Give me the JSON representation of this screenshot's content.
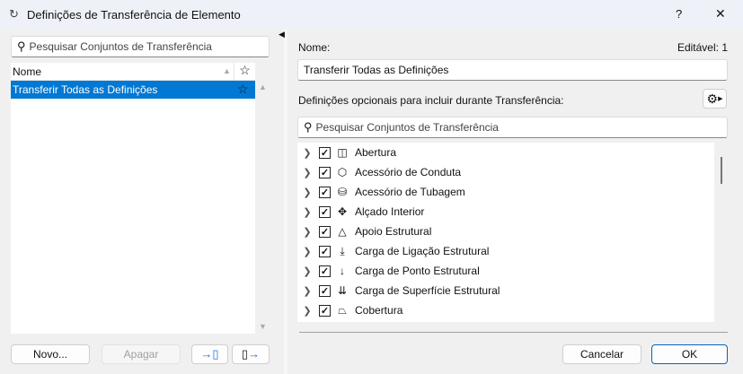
{
  "window": {
    "title": "Definições de Transferência de Elemento",
    "help": "?",
    "close": "✕"
  },
  "left": {
    "search_placeholder": "Pesquisar Conjuntos de Transferência",
    "column_name": "Nome",
    "rows": [
      {
        "name": "Transferir Todas as Definições",
        "selected": true
      }
    ],
    "buttons": {
      "new": "Novo...",
      "delete": "Apagar"
    }
  },
  "right": {
    "name_label": "Nome:",
    "editable": "Editável: 1",
    "name_value": "Transferir Todas as Definições",
    "optional_label": "Definições opcionais para incluir durante Transferência:",
    "search_placeholder": "Pesquisar Conjuntos de Transferência",
    "items": [
      {
        "label": "Abertura",
        "checked": true,
        "icon": "opening-icon"
      },
      {
        "label": "Acessório de Conduta",
        "checked": true,
        "icon": "duct-fitting-icon"
      },
      {
        "label": "Acessório de Tubagem",
        "checked": true,
        "icon": "pipe-fitting-icon"
      },
      {
        "label": "Alçado Interior",
        "checked": true,
        "icon": "interior-elevation-icon"
      },
      {
        "label": "Apoio Estrutural",
        "checked": true,
        "icon": "structural-support-icon"
      },
      {
        "label": "Carga de Ligação Estrutural",
        "checked": true,
        "icon": "line-load-icon"
      },
      {
        "label": "Carga de Ponto Estrutural",
        "checked": true,
        "icon": "point-load-icon"
      },
      {
        "label": "Carga de Superfície Estrutural",
        "checked": true,
        "icon": "surface-load-icon"
      },
      {
        "label": "Cobertura",
        "checked": true,
        "icon": "roof-icon"
      }
    ],
    "buttons": {
      "cancel": "Cancelar",
      "ok": "OK"
    }
  }
}
